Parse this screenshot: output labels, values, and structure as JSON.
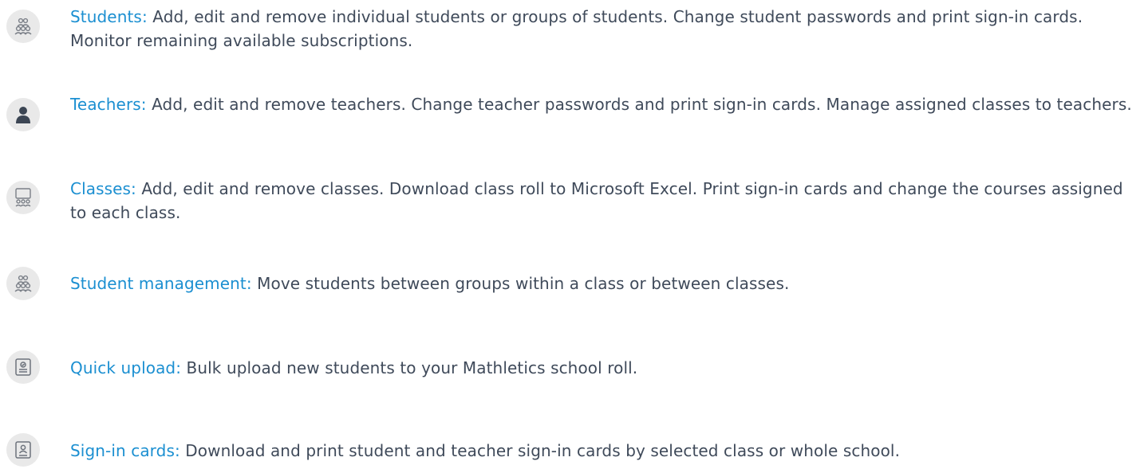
{
  "colors": {
    "label": "#1b8fd1",
    "text": "#3f4a5a",
    "icon_bg": "#e9e9e9",
    "icon_stroke": "#7a7f87"
  },
  "features": [
    {
      "icon": "students-group-icon",
      "label": "Students:",
      "description": "Add, edit and remove individual students or groups of students. Change student passwords and print sign-in cards. Monitor remaining available subscriptions."
    },
    {
      "icon": "teacher-person-icon",
      "label": "Teachers:",
      "description": "Add, edit and remove teachers. Change teacher passwords and print sign-in cards. Manage assigned classes to teachers."
    },
    {
      "icon": "classroom-board-icon",
      "label": "Classes:",
      "description": "Add, edit and remove classes. Download class roll to Microsoft Excel. Print sign-in cards and change the courses assigned to each class."
    },
    {
      "icon": "student-management-icon",
      "label": "Student management:",
      "description": "Move students between groups within a class or between classes."
    },
    {
      "icon": "quick-upload-icon",
      "label": "Quick upload:",
      "description": "Bulk upload new students to your Mathletics school roll."
    },
    {
      "icon": "sign-in-card-icon",
      "label": "Sign-in cards:",
      "description": "Download and print student and teacher sign-in cards by selected class or whole school."
    }
  ]
}
